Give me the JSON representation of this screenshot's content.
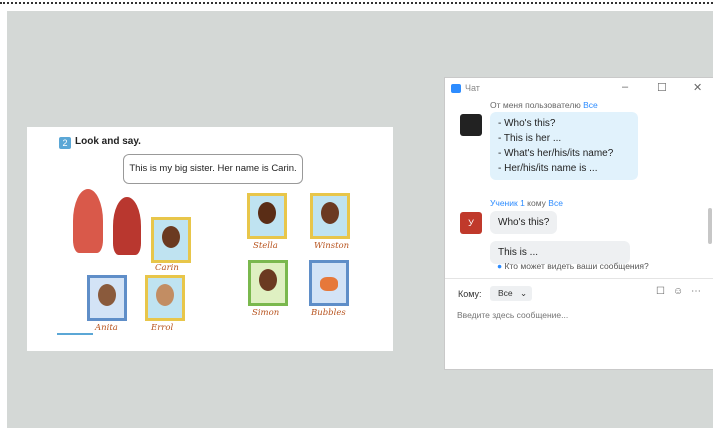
{
  "slide": {
    "task_number": "2",
    "task_title": "Look and say.",
    "speech": "This is my big sister. Her name is Carin.",
    "captions": [
      "Carin",
      "Stella",
      "Winston",
      "Anita",
      "Errol",
      "Simon",
      "Bubbles"
    ]
  },
  "chat": {
    "title": "Чат",
    "minimize": "–",
    "maximize": "☐",
    "close": "✕",
    "messages": [
      {
        "header_prefix": "От меня пользователю ",
        "header_link": "Все",
        "lines": [
          "- Who's this?",
          "- This is her ...",
          "- What's her/his/its name?",
          "- Her/his/its name is ..."
        ]
      },
      {
        "sender": "Ученик 1",
        "header_mid": " кому ",
        "header_link": "Все",
        "avatar_letter": "У",
        "text": "Who's this?"
      }
    ],
    "partial_text": "This is ...",
    "privacy": "Кто может видеть ваши сообщения?",
    "to_label": "Кому:",
    "to_value": "Все",
    "placeholder": "Введите здесь сообщение..."
  },
  "colors": {
    "accent": "#2d8cff",
    "bubble": "#e1f2fc",
    "avatar_red": "#c0392b"
  }
}
